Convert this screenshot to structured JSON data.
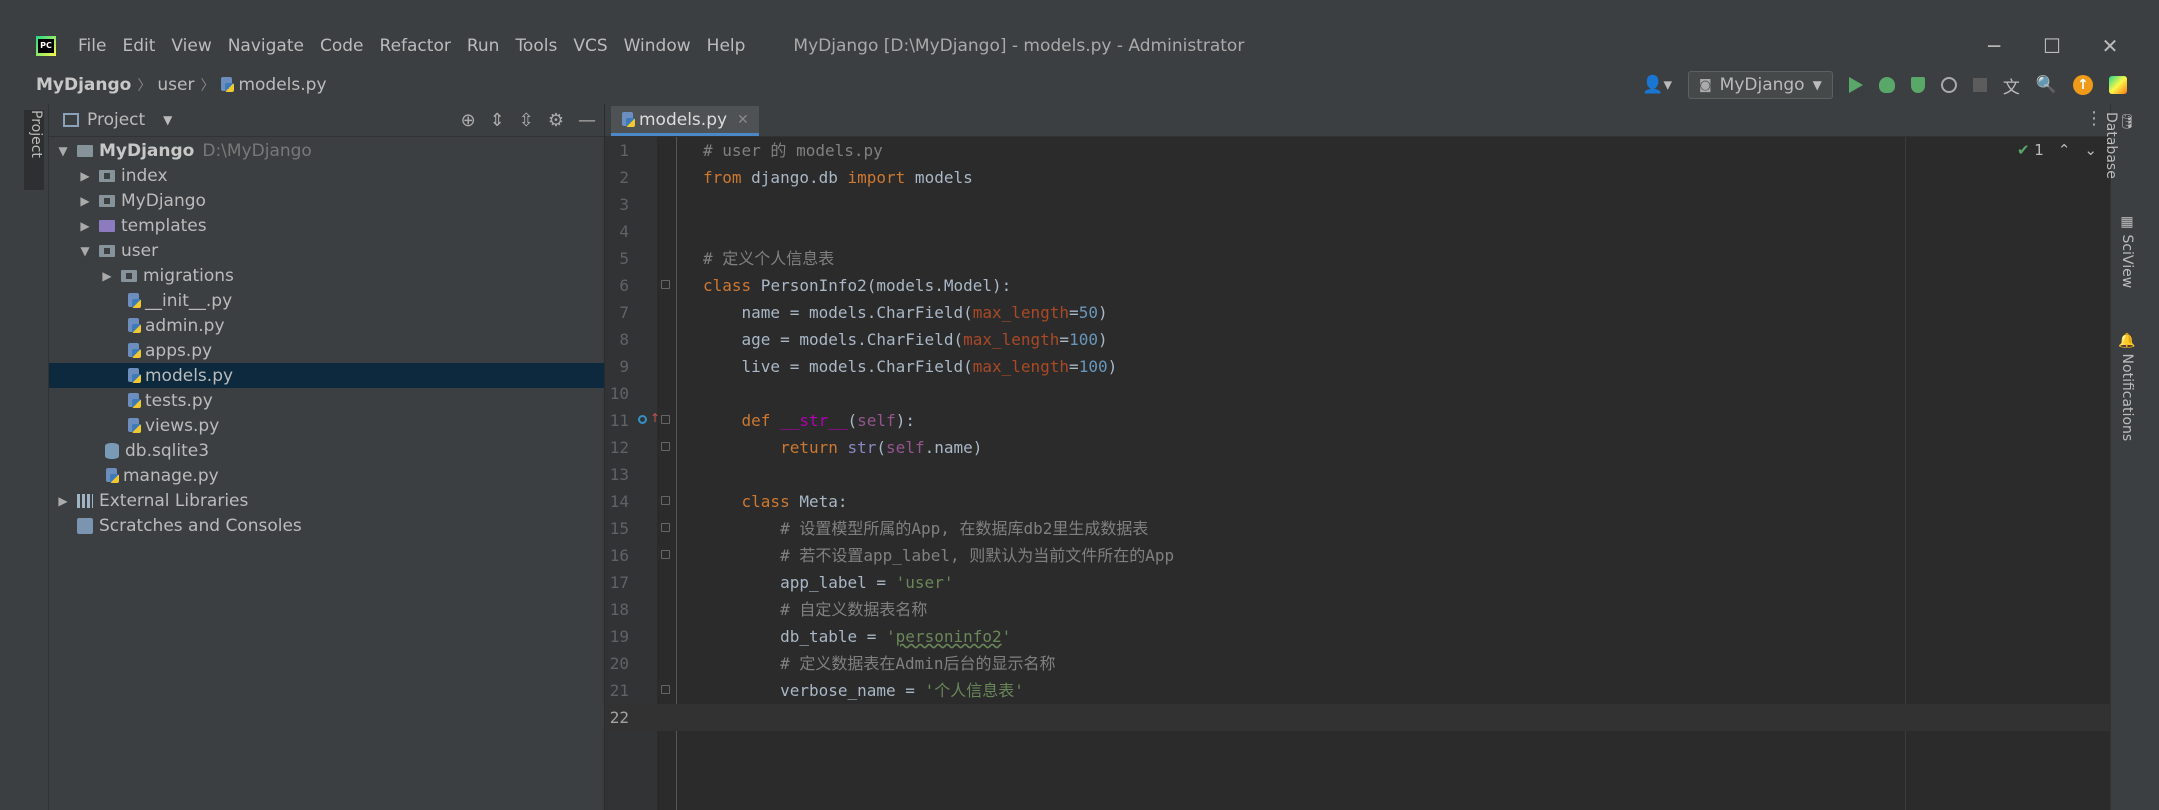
{
  "menu": [
    "File",
    "Edit",
    "View",
    "Navigate",
    "Code",
    "Refactor",
    "Run",
    "Tools",
    "VCS",
    "Window",
    "Help"
  ],
  "window_title": "MyDjango [D:\\MyDjango] - models.py - Administrator",
  "window_controls": {
    "minimize": "─",
    "maximize": "☐",
    "close": "✕"
  },
  "breadcrumb": {
    "project": "MyDjango",
    "folder": "user",
    "file": "models.py"
  },
  "run_config": "MyDjango",
  "left_strip": {
    "project_label": "Project"
  },
  "right_strip": {
    "database": "Database",
    "sciview": "SciView",
    "notifications": "Notifications"
  },
  "project_panel": {
    "title": "Project"
  },
  "tree": {
    "root": {
      "name": "MyDjango",
      "path": "D:\\MyDjango"
    },
    "index": "index",
    "mydjango": "MyDjango",
    "templates": "templates",
    "user": "user",
    "migrations": "migrations",
    "init": "__init__.py",
    "admin": "admin.py",
    "apps": "apps.py",
    "models": "models.py",
    "tests": "tests.py",
    "views": "views.py",
    "db": "db.sqlite3",
    "manage": "manage.py",
    "ext": "External Libraries",
    "scratches": "Scratches and Consoles"
  },
  "editor": {
    "tab": "models.py",
    "inspection_count": "1",
    "line_numbers": [
      "1",
      "2",
      "3",
      "4",
      "5",
      "6",
      "7",
      "8",
      "9",
      "10",
      "11",
      "12",
      "13",
      "14",
      "15",
      "16",
      "17",
      "18",
      "19",
      "20",
      "21",
      "22"
    ],
    "code": {
      "l1": "# user 的 models.py",
      "l2_from": "from",
      "l2_mod": " django.db ",
      "l2_import": "import",
      "l2_rest": " models",
      "l5": "# 定义个人信息表",
      "l6_kw": "class",
      "l6_rest": " PersonInfo2(models.Model):",
      "l7_a": "    name = models.CharField(",
      "l7_p": "max_length",
      "l7_eq": "=",
      "l7_n": "50",
      "l7_e": ")",
      "l8_a": "    age = models.CharField(",
      "l8_p": "max_length",
      "l8_eq": "=",
      "l8_n": "100",
      "l8_e": ")",
      "l9_a": "    live = models.CharField(",
      "l9_p": "max_length",
      "l9_eq": "=",
      "l9_n": "100",
      "l9_e": ")",
      "l11_ind": "    ",
      "l11_kw": "def",
      "l11_sp": " ",
      "l11_fn": "__str__",
      "l11_o": "(",
      "l11_self": "self",
      "l11_c": "):",
      "l12_ind": "        ",
      "l12_kw": "return",
      "l12_sp": " ",
      "l12_bi": "str",
      "l12_o": "(",
      "l12_self": "self",
      "l12_r": ".name)",
      "l14_ind": "    ",
      "l14_kw": "class",
      "l14_rest": " Meta:",
      "l15": "        # 设置模型所属的App, 在数据库db2里生成数据表",
      "l16": "        # 若不设置app_label, 则默认为当前文件所在的App",
      "l17_a": "        app_label = ",
      "l17_s": "'user'",
      "l18": "        # 自定义数据表名称",
      "l19_a": "        db_table = ",
      "l19_q1": "'",
      "l19_s": "personinfo2",
      "l19_q2": "'",
      "l20": "        # 定义数据表在Admin后台的显示名称",
      "l21_a": "        verbose_name = ",
      "l21_s": "'个人信息表'"
    }
  },
  "colors": {
    "comment": "#808080",
    "keyword": "#cc7832",
    "number": "#6897bb",
    "string": "#6a8759",
    "param": "#aa4926",
    "self": "#94558d",
    "selection": "#0d293e"
  }
}
